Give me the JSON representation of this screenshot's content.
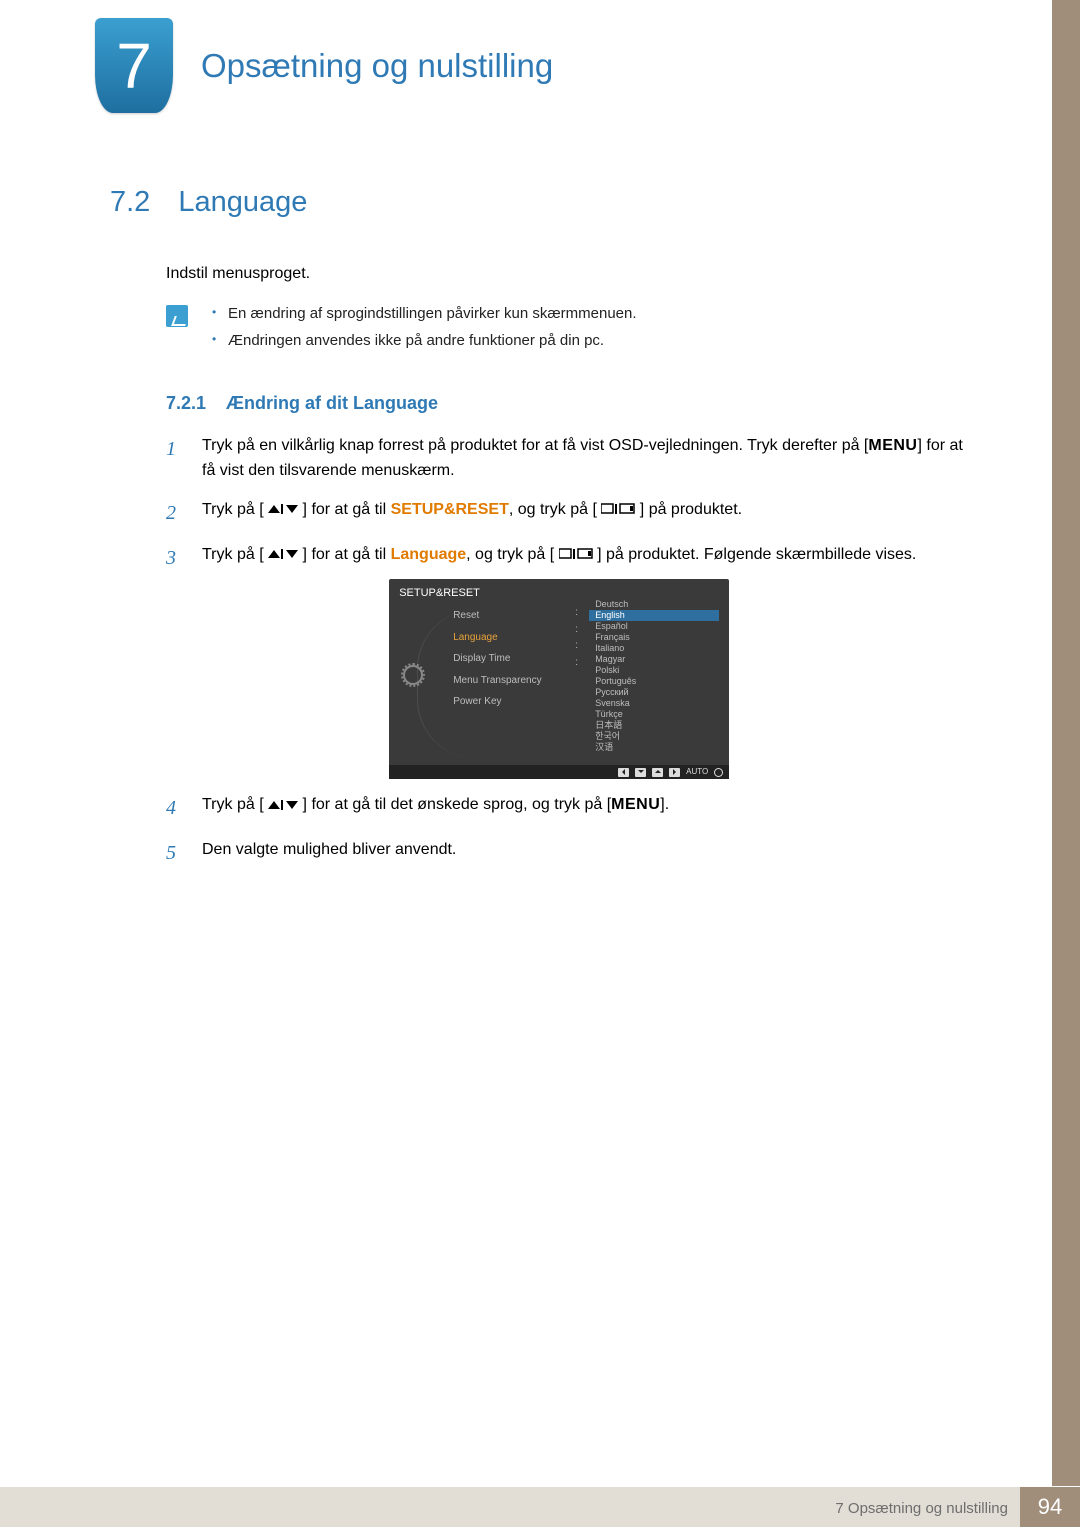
{
  "chapter": {
    "number": "7",
    "title": "Opsætning og nulstilling"
  },
  "section": {
    "number": "7.2",
    "title": "Language",
    "intro": "Indstil menusproget.",
    "notes": [
      "En ændring af sprogindstillingen påvirker kun skærmmenuen.",
      "Ændringen anvendes ikke på andre funktioner på din pc."
    ]
  },
  "subsection": {
    "number": "7.2.1",
    "title": "Ændring af dit Language"
  },
  "steps": {
    "s1a": "Tryk på en vilkårlig knap forrest på produktet for at få vist OSD-vejledningen. Tryk derefter på [",
    "s1_menu": "MENU",
    "s1b": "] for at få vist den tilsvarende menuskærm.",
    "s2a": "Tryk på [",
    "s2b": "] for at gå til ",
    "s2_hl": "SETUP&RESET",
    "s2c": ", og tryk på [",
    "s2d": "] på produktet.",
    "s3a": "Tryk på [",
    "s3b": "] for at gå til ",
    "s3_hl": "Language",
    "s3c": ", og tryk på [",
    "s3d": "] på produktet. Følgende skærmbillede vises.",
    "s4a": "Tryk på [",
    "s4b": "] for at gå til det ønskede sprog, og tryk på [",
    "s4_menu": "MENU",
    "s4c": "].",
    "s5": "Den valgte mulighed bliver anvendt."
  },
  "osd": {
    "title": "SETUP&RESET",
    "left_items": [
      "Reset",
      "Language",
      "Display Time",
      "Menu Transparency",
      "Power Key"
    ],
    "active_left": "Language",
    "languages": [
      "Deutsch",
      "English",
      "Español",
      "Français",
      "Italiano",
      "Magyar",
      "Polski",
      "Português",
      "Русский",
      "Svenska",
      "Türkçe",
      "日本語",
      "한국어",
      "汉语"
    ],
    "selected_language": "English",
    "auto_label": "AUTO"
  },
  "footer": {
    "text": "7 Opsætning og nulstilling",
    "page": "94"
  }
}
